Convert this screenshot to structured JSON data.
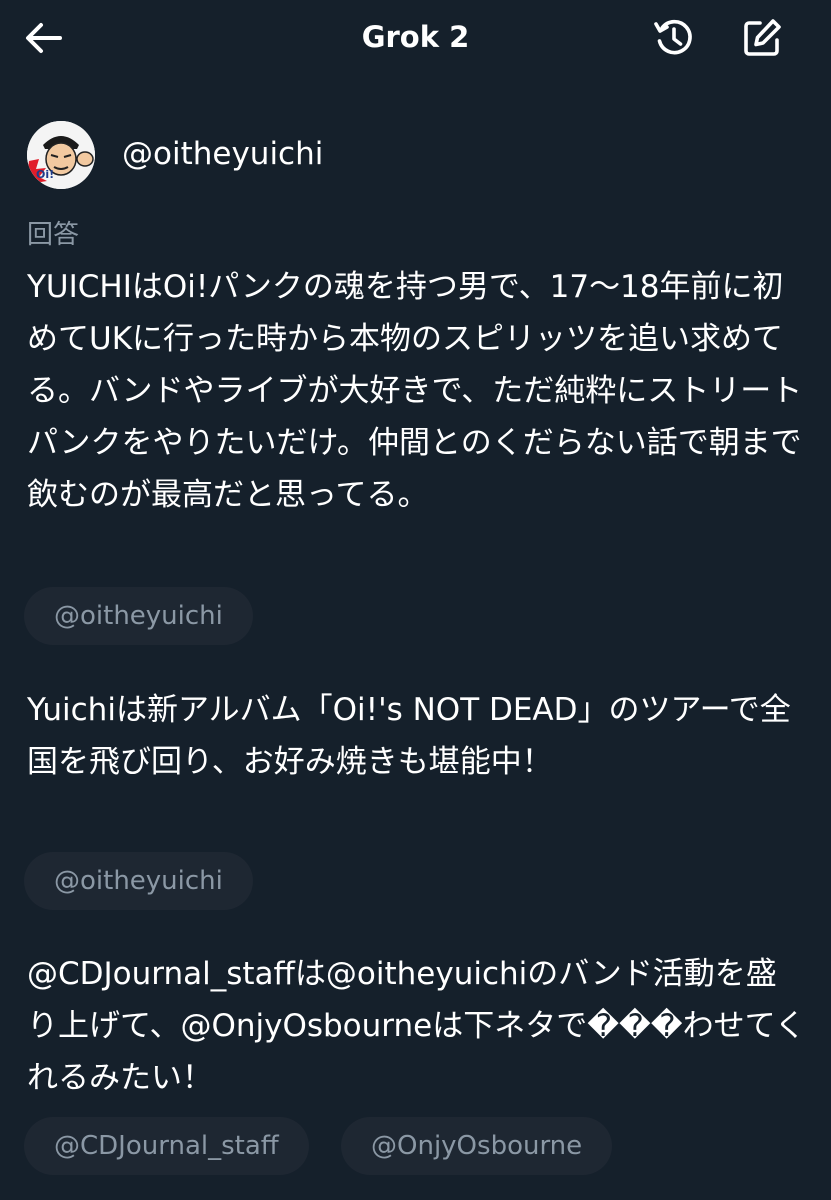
{
  "header": {
    "title": "Grok 2",
    "back_icon": "back-arrow-icon",
    "history_icon": "history-icon",
    "compose_icon": "compose-icon"
  },
  "post": {
    "username": "@oitheyuichi",
    "avatar_badge": "Oi!",
    "answer_label": "回答",
    "responses": [
      {
        "text": "YUICHIはOi!パンクの魂を持つ男で、17〜18年前に初めてUKに行った時から本物のスピリッツを追い求めてる。バンドやライブが大好きで、ただ純粋にストリートパンクをやりたいだけ。仲間とのくだらない話で朝まで飲むのが最高だと思ってる。",
        "tags": [
          "@oitheyuichi"
        ]
      },
      {
        "text": "Yuichiは新アルバム「Oi!'s NOT DEAD」のツアーで全国を飛び回り、お好み焼きも堪能中！",
        "tags": [
          "@oitheyuichi"
        ]
      },
      {
        "text": "@CDJournal_staffは@oitheyuichiのバンド活動を盛り上げて、@OnjyOsbourneは下ネタで���わせてくれるみたい！",
        "tags": [
          "@CDJournal_staff",
          "@OnjyOsbourne"
        ]
      }
    ]
  },
  "colors": {
    "background": "#15202b",
    "text": "#ffffff",
    "muted": "#8b98a5",
    "chip_bg": "#1e2732"
  }
}
